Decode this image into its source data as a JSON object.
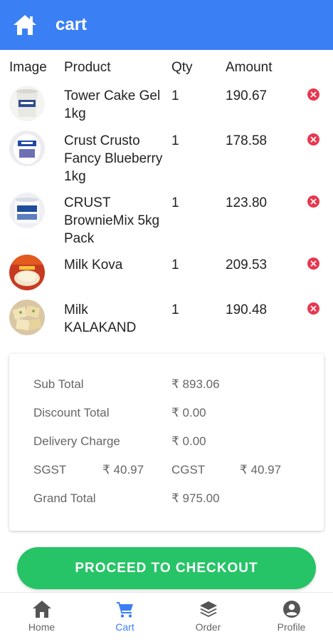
{
  "header": {
    "title": "cart"
  },
  "table": {
    "headers": {
      "image": "Image",
      "product": "Product",
      "qty": "Qty",
      "amount": "Amount"
    },
    "rows": [
      {
        "name": "Tower Cake Gel 1kg",
        "qty": "1",
        "amount": "190.67"
      },
      {
        "name": "Crust Crusto Fancy Blueberry 1kg",
        "qty": "1",
        "amount": "178.58"
      },
      {
        "name": "CRUST BrownieMix 5kg Pack",
        "qty": "1",
        "amount": "123.80"
      },
      {
        "name": "Milk Kova",
        "qty": "1",
        "amount": "209.53"
      },
      {
        "name": "Milk KALAKAND",
        "qty": "1",
        "amount": "190.48"
      }
    ]
  },
  "summary": {
    "sub_total_label": "Sub Total",
    "sub_total": "₹ 893.06",
    "discount_label": "Discount Total",
    "discount": "₹ 0.00",
    "delivery_label": "Delivery Charge",
    "delivery": "₹ 0.00",
    "sgst_label": "SGST",
    "sgst": "₹ 40.97",
    "cgst_label": "CGST",
    "cgst": "₹ 40.97",
    "grand_total_label": "Grand Total",
    "grand_total": "₹ 975.00"
  },
  "checkout": {
    "label": "PROCEED TO CHECKOUT"
  },
  "nav": {
    "items": [
      {
        "label": "Home",
        "icon": "home-icon"
      },
      {
        "label": "Cart",
        "icon": "cart-icon"
      },
      {
        "label": "Order",
        "icon": "layers-icon"
      },
      {
        "label": "Profile",
        "icon": "profile-icon"
      }
    ]
  },
  "colors": {
    "primary": "#3b7ff5",
    "checkout": "#27c467",
    "delete": "#e8374f"
  }
}
